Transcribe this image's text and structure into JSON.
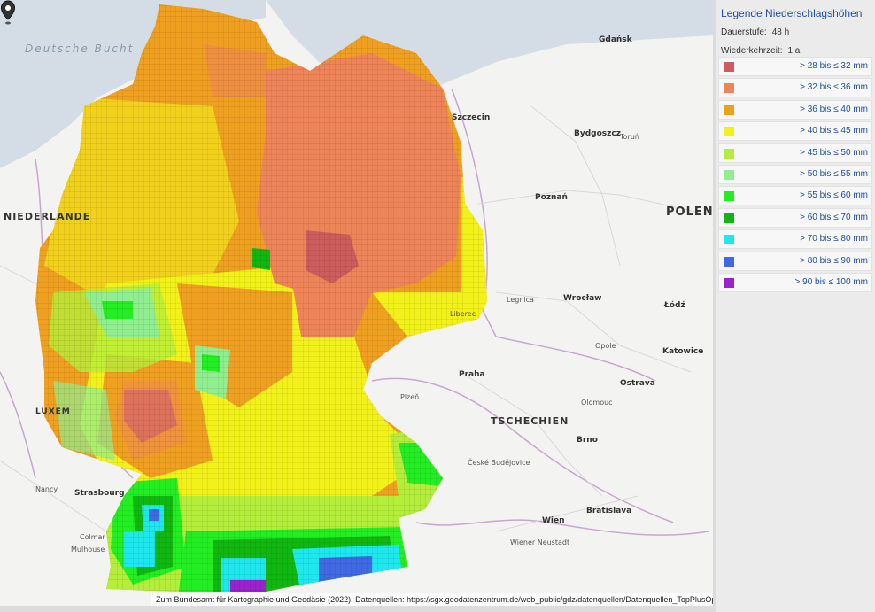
{
  "legend": {
    "title": "Legende Niederschlagshöhen",
    "dauerstufe_label": "Dauerstufe:",
    "dauerstufe_value": "48 h",
    "wiederkehrzeit_label": "Wiederkehrzeit:",
    "wiederkehrzeit_value": "1 a",
    "classes": [
      {
        "label": "> 28 bis ≤ 32 mm",
        "color": "#cd5c5c"
      },
      {
        "label": "> 32 bis ≤ 36 mm",
        "color": "#ee8559"
      },
      {
        "label": "> 36 bis ≤ 40 mm",
        "color": "#f0a020"
      },
      {
        "label": "> 40 bis ≤ 45 mm",
        "color": "#f2f21a"
      },
      {
        "label": "> 45 bis ≤ 50 mm",
        "color": "#b4ee3a"
      },
      {
        "label": "> 50 bis ≤ 55 mm",
        "color": "#90ee90"
      },
      {
        "label": "> 55 bis ≤ 60 mm",
        "color": "#22ee22"
      },
      {
        "label": "> 60 bis ≤ 70 mm",
        "color": "#11b711"
      },
      {
        "label": "> 70 bis ≤ 80 mm",
        "color": "#1ee7ee"
      },
      {
        "label": "> 80 bis ≤ 90 mm",
        "color": "#4169e1"
      },
      {
        "label": "> 90 bis ≤ 100 mm",
        "color": "#9a22cc"
      }
    ]
  },
  "map": {
    "attribution": "Zum Bundesamt für Kartographie und Geodäsie (2022), Datenquellen: https://sgx.geodatenzentrum.de/web_public/gdz/datenquellen/Datenquellen_TopPlusOpen.html",
    "marker_icon": "map-pin-icon",
    "labels": {
      "sea": "Deutsche Bucht",
      "niederlande": "NIEDERLANDE",
      "polen": "POLEN",
      "tschechien": "TSCHECHIEN",
      "luxemburg": "LUXEM",
      "strasbourg": "Strasbourg",
      "praha": "Praha",
      "wien": "Wien",
      "bratislava": "Bratislava",
      "gdansk": "Gdańsk",
      "szczecin": "Szczecin",
      "bydgoszcz": "Bydgoszcz",
      "poznan": "Poznań",
      "wroclaw": "Wrocław",
      "lodz": "Łódź",
      "katowice": "Katowice",
      "brno": "Brno",
      "ostrava": "Ostrava",
      "olomouc": "Olomouc",
      "plzen": "Plzeň",
      "nancy": "Nancy",
      "mulhouse": "Mulhouse",
      "colmar": "Colmar",
      "lodz_w": "Lodz",
      "opole": "Opole",
      "legnica": "Legnica",
      "liberec": "Liberec",
      "torun": "Toruń",
      "ceske": "České Budějovice",
      "linz_area": "Wiener Neustadt"
    }
  }
}
